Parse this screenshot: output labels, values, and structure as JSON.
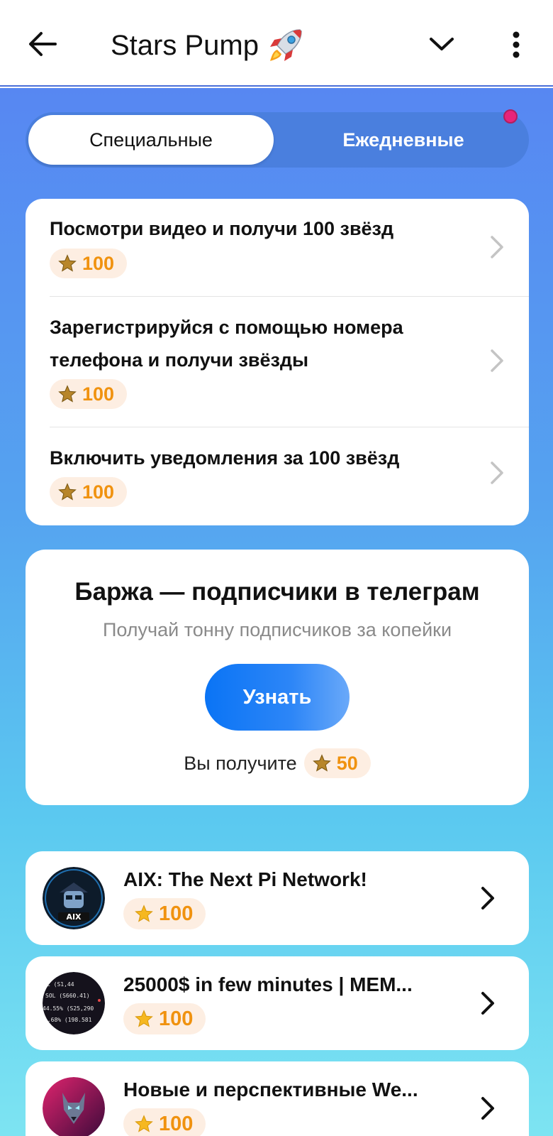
{
  "header": {
    "title": "Stars Pump",
    "title_emoji_icon": "rocket-icon"
  },
  "tabs": {
    "special_label": "Специальные",
    "daily_label": "Ежедневные",
    "active": "special"
  },
  "tasks": [
    {
      "title": "Посмотри видео и получи 100 звёзд",
      "reward": "100"
    },
    {
      "title": "Зарегистрируйся с помощью номера телефона и получи звёзды",
      "reward": "100"
    },
    {
      "title": "Включить уведомления за 100 звёзд",
      "reward": "100"
    }
  ],
  "ad": {
    "title": "Баржа — подписчики в телеграм",
    "subtitle": "Получай тонну подписчиков за копейки",
    "button_label": "Узнать",
    "reward_prefix": "Вы получите",
    "reward": "50"
  },
  "channels": [
    {
      "title": "AIX: The Next Pi Network!",
      "reward": "100",
      "avatar": "aix-logo"
    },
    {
      "title": "25000$ in few minutes | MEM...",
      "reward": "100",
      "avatar": "crypto-ticker"
    },
    {
      "title": "Новые и перспективные We...",
      "reward": "100",
      "avatar": "wolf-art"
    }
  ],
  "colors": {
    "accent_blue": "#0a74f5",
    "reward_orange": "#f0920f",
    "reward_bg": "#fdeee2",
    "notification_dot": "#e8247a"
  }
}
